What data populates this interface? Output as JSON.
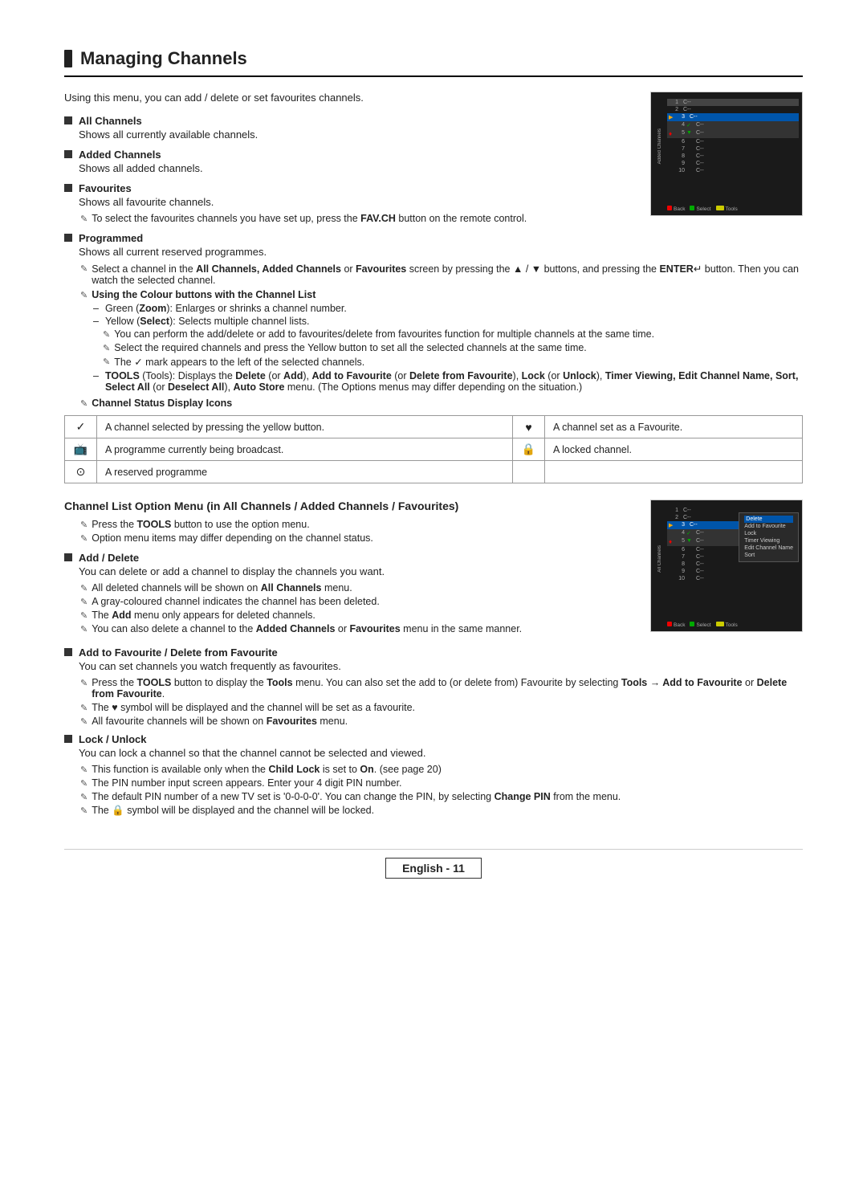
{
  "page": {
    "title": "Managing Channels",
    "footer": "English - 11"
  },
  "intro": "Using this menu, you can add / delete or set favourites channels.",
  "sections": [
    {
      "id": "all-channels",
      "header": "All Channels",
      "desc": "Shows all currently available channels."
    },
    {
      "id": "added-channels",
      "header": "Added Channels",
      "desc": "Shows all added channels."
    },
    {
      "id": "favourites",
      "header": "Favourites",
      "desc": "Shows all favourite channels."
    },
    {
      "id": "programmed",
      "header": "Programmed",
      "desc": "Shows all current reserved programmes."
    }
  ],
  "channelStatusTitle": "Channel Status Display Icons",
  "statusIcons": [
    {
      "icon": "✓",
      "desc": "A channel selected by pressing the yellow button.",
      "icon2": "♥",
      "desc2": "A channel set as a Favourite."
    },
    {
      "icon": "☐",
      "desc": "A programme currently being broadcast.",
      "icon2": "🔒",
      "desc2": "A locked channel."
    },
    {
      "icon": "⊙",
      "desc": "A reserved programme",
      "icon2": "",
      "desc2": ""
    }
  ],
  "channelListOption": {
    "title": "Channel List Option Menu (in All Channels / Added Channels / Favourites)",
    "notes": [
      "Press the TOOLS button to use the option menu.",
      "Option menu items may differ depending on the channel status."
    ]
  },
  "addDelete": {
    "header": "Add / Delete",
    "desc": "You can delete or add a channel to display the channels you want.",
    "notes": [
      "All deleted channels will be shown on All Channels menu.",
      "A gray-coloured channel indicates the channel has been deleted.",
      "The Add menu only appears for deleted channels.",
      "You can also delete a channel to the Added Channels or Favourites menu in the same manner."
    ]
  },
  "addFavourite": {
    "header": "Add to Favourite / Delete from Favourite",
    "desc": "You can set channels you watch frequently as favourites.",
    "notes": [
      "Press the TOOLS button to display the Tools menu. You can also set the add to (or delete from) Favourite by selecting Tools → Add to Favourite or Delete from Favourite.",
      "The ♥ symbol will be displayed and the channel will be set as a favourite.",
      "All favourite channels will be shown on Favourites menu."
    ]
  },
  "lockUnlock": {
    "header": "Lock / Unlock",
    "desc": "You can lock a channel so that the channel cannot be selected and viewed.",
    "notes": [
      "This function is available only when the Child Lock is set to On. (see page 20)",
      "The PIN number input screen appears. Enter your 4 digit PIN number.",
      "The default PIN number of a new TV set is '0-0-0-0'. You can change the PIN, by selecting Change PIN from the menu.",
      "The 🔒 symbol will be displayed and the channel will be locked."
    ]
  },
  "tv1": {
    "sidebarLabel": "Added Channels",
    "channels": [
      {
        "num": "1",
        "name": "C--",
        "selected": false
      },
      {
        "num": "2",
        "name": "C--",
        "selected": false
      },
      {
        "num": "3",
        "name": "C--",
        "selected": true
      },
      {
        "num": "4",
        "name": "C--",
        "selected": false
      },
      {
        "num": "5",
        "name": "C--",
        "selected": false
      },
      {
        "num": "6",
        "name": "C--",
        "selected": false
      },
      {
        "num": "7",
        "name": "C--",
        "selected": false
      },
      {
        "num": "8",
        "name": "C--",
        "selected": false
      },
      {
        "num": "9",
        "name": "C--",
        "selected": false
      },
      {
        "num": "10",
        "name": "C--",
        "selected": false
      }
    ]
  },
  "tv2": {
    "sidebarLabel": "All Channels",
    "channels": [
      {
        "num": "1",
        "name": "C--",
        "selected": false
      },
      {
        "num": "2",
        "name": "C--",
        "selected": false
      },
      {
        "num": "3",
        "name": "C--",
        "selected": true
      },
      {
        "num": "4",
        "name": "C--",
        "selected": false
      },
      {
        "num": "5",
        "name": "C--",
        "selected": false
      },
      {
        "num": "6",
        "name": "C--",
        "selected": false
      },
      {
        "num": "7",
        "name": "C--",
        "selected": false
      },
      {
        "num": "8",
        "name": "C--",
        "selected": false
      },
      {
        "num": "9",
        "name": "C--",
        "selected": false
      },
      {
        "num": "10",
        "name": "C--",
        "selected": false
      }
    ],
    "menuItems": [
      {
        "label": "Delete",
        "active": true
      },
      {
        "label": "Add to Favourite",
        "active": false
      },
      {
        "label": "Lock",
        "active": false
      },
      {
        "label": "Timer Viewing",
        "active": false
      },
      {
        "label": "Edit Channel Name",
        "active": false
      },
      {
        "label": "Sort",
        "active": false
      }
    ]
  }
}
